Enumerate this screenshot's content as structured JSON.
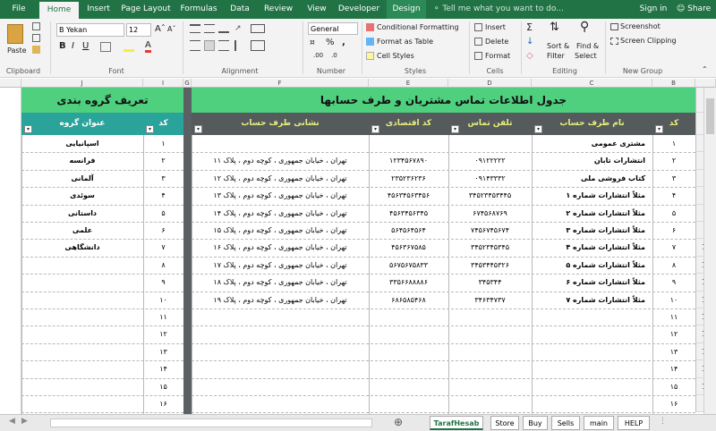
{
  "ribbon_tabs": [
    "File",
    "Home",
    "Insert",
    "Page Layout",
    "Formulas",
    "Data",
    "Review",
    "View",
    "Developer",
    "Design"
  ],
  "tell_me": "Tell me what you want to do...",
  "sign_in": "Sign in",
  "share": "Share",
  "clipboard": {
    "paste": "Paste",
    "label": "Clipboard"
  },
  "font": {
    "name": "B Yekan",
    "size": "12",
    "label": "Font"
  },
  "alignment": {
    "label": "Alignment"
  },
  "number": {
    "format": "General",
    "label": "Number"
  },
  "styles": {
    "conditional": "Conditional Formatting",
    "format_table": "Format as Table",
    "cell_styles": "Cell Styles",
    "label": "Styles"
  },
  "cells": {
    "insert": "Insert",
    "delete": "Delete",
    "format": "Format",
    "label": "Cells"
  },
  "editing": {
    "sort": "Sort &",
    "filter": "Filter",
    "find": "Find &",
    "select": "Select",
    "label": "Editing"
  },
  "newgroup": {
    "screenshot": "Screenshot",
    "clipping": "Screen Clipping",
    "label": "New Group"
  },
  "col_letters": [
    "B",
    "C",
    "D",
    "E",
    "F",
    "G",
    "I",
    "J"
  ],
  "main_title": "جدول اطلاعات تماس مشتریان و طرف حسابها",
  "group_title": "تعریف گروه بندی",
  "main_headers": {
    "code": "کد",
    "name": "نام طرف حساب",
    "phone": "تلفن تماس",
    "econ": "کد اقتصادی",
    "address": "نشانی طرف حساب"
  },
  "group_headers": {
    "code": "کد",
    "title": "عنوان گروه"
  },
  "row_numbers": [
    "1",
    "2",
    "3",
    "4",
    "5",
    "6",
    "7",
    "8",
    "9",
    "10",
    "11",
    "12",
    "13",
    "14",
    "15",
    "16",
    "17",
    "18"
  ],
  "main_rows": [
    {
      "code": "۱",
      "name": "مشتری عمومی",
      "phone": "",
      "econ": "",
      "address": ""
    },
    {
      "code": "۲",
      "name": "انتشارات تابان",
      "phone": "۰۹۱۲۲۲۲۲",
      "econ": "۱۲۳۴۵۶۷۸۹۰",
      "address": "تهران ، خیابان جمهوری ، کوچه دوم ، پلاک ۱۱"
    },
    {
      "code": "۳",
      "name": "کتاب فروشی ملی",
      "phone": "۰۹۱۴۳۳۳۲",
      "econ": "۲۳۵۲۳۶۲۳۶",
      "address": "تهران ، خیابان جمهوری ، کوچه دوم ، پلاک ۱۲"
    },
    {
      "code": "۴",
      "name": "مثلاً انتشارات شماره ۱",
      "phone": "۳۴۵۲۳۴۵۳۴۴۵",
      "econ": "۴۵۶۳۴۵۶۳۴۵۶",
      "address": "تهران ، خیابان جمهوری ، کوچه دوم ، پلاک ۱۳"
    },
    {
      "code": "۵",
      "name": "مثلاً انتشارات شماره ۲",
      "phone": "۶۷۴۵۶۸۷۶۹",
      "econ": "۴۵۶۳۴۵۶۳۴۵",
      "address": "تهران ، خیابان جمهوری ، کوچه دوم ، پلاک ۱۴"
    },
    {
      "code": "۶",
      "name": "مثلاً انتشارات شماره ۳",
      "phone": "۷۴۵۶۷۴۵۶۷۴",
      "econ": "۵۶۴۵۶۴۵۶۴",
      "address": "تهران ، خیابان جمهوری ، کوچه دوم ، پلاک ۱۵"
    },
    {
      "code": "۷",
      "name": "مثلاً انتشارات شماره ۴",
      "phone": "۳۴۵۲۳۴۵۳۴۵",
      "econ": "۴۵۶۳۶۷۵۸۵",
      "address": "تهران ، خیابان جمهوری ، کوچه دوم ، پلاک ۱۶"
    },
    {
      "code": "۸",
      "name": "مثلاً انتشارات شماره ۵",
      "phone": "۳۴۵۳۴۴۵۳۲۶",
      "econ": "۵۶۷۵۶۷۵۸۳۳",
      "address": "تهران ، خیابان جمهوری ، کوچه دوم ، پلاک ۱۷"
    },
    {
      "code": "۹",
      "name": "مثلاً انتشارات شماره ۶",
      "phone": "۳۴۵۳۴۴",
      "econ": "۳۳۵۶۶۸۸۸۸۶",
      "address": "تهران ، خیابان جمهوری ، کوچه دوم ، پلاک ۱۸"
    },
    {
      "code": "۱۰",
      "name": "مثلاً انتشارات شماره ۷",
      "phone": "۳۴۶۳۴۷۳۷",
      "econ": "۶۸۶۵۸۵۴۶۸",
      "address": "تهران ، خیابان جمهوری ، کوچه دوم ، پلاک ۱۹"
    },
    {
      "code": "۱۱",
      "name": "",
      "phone": "",
      "econ": "",
      "address": ""
    },
    {
      "code": "۱۲",
      "name": "",
      "phone": "",
      "econ": "",
      "address": ""
    },
    {
      "code": "۱۳",
      "name": "",
      "phone": "",
      "econ": "",
      "address": ""
    },
    {
      "code": "۱۴",
      "name": "",
      "phone": "",
      "econ": "",
      "address": ""
    },
    {
      "code": "۱۵",
      "name": "",
      "phone": "",
      "econ": "",
      "address": ""
    },
    {
      "code": "۱۶",
      "name": "",
      "phone": "",
      "econ": "",
      "address": ""
    }
  ],
  "group_rows": [
    {
      "code": "۱",
      "title": "اسپانیایی"
    },
    {
      "code": "۲",
      "title": "فرانسه"
    },
    {
      "code": "۳",
      "title": "آلمانی"
    },
    {
      "code": "۴",
      "title": "سوئدی"
    },
    {
      "code": "۵",
      "title": "داستانی"
    },
    {
      "code": "۶",
      "title": "علمی"
    },
    {
      "code": "۷",
      "title": "دانشگاهی"
    },
    {
      "code": "۸",
      "title": ""
    },
    {
      "code": "۹",
      "title": ""
    },
    {
      "code": "۱۰",
      "title": ""
    },
    {
      "code": "۱۱",
      "title": ""
    },
    {
      "code": "۱۲",
      "title": ""
    },
    {
      "code": "۱۳",
      "title": ""
    },
    {
      "code": "۱۴",
      "title": ""
    },
    {
      "code": "۱۵",
      "title": ""
    },
    {
      "code": "۱۶",
      "title": ""
    }
  ],
  "sheet_tabs": [
    "TarafHesab",
    "Store",
    "Buy",
    "Sells",
    "main",
    "HELP"
  ],
  "colors": {
    "excel_green": "#217346",
    "title_green": "#4fd07f",
    "header_dark": "#555b5d",
    "header_teal": "#2aa39a"
  }
}
